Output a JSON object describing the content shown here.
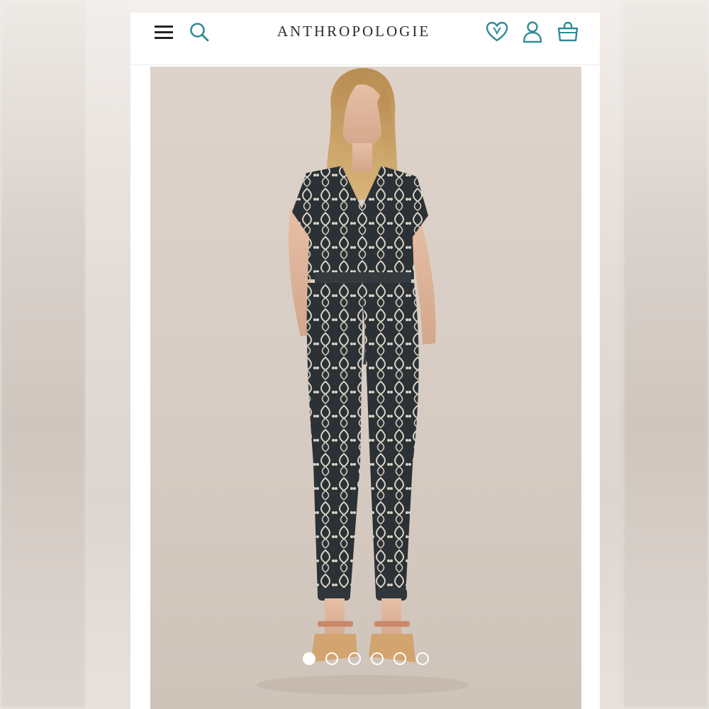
{
  "header": {
    "logo_text": "ANTHROPOLOGIE",
    "icons": {
      "menu": "hamburger-menu-icon",
      "search": "search-icon",
      "wishlist": "heart-icon",
      "account": "user-icon",
      "bag": "shopping-bag-icon"
    },
    "accent_color": "#2f8a96"
  },
  "product": {
    "image_description_icon": "jumpsuit-product-photo",
    "carousel": {
      "total_slides": 6,
      "active_index": 0
    }
  }
}
